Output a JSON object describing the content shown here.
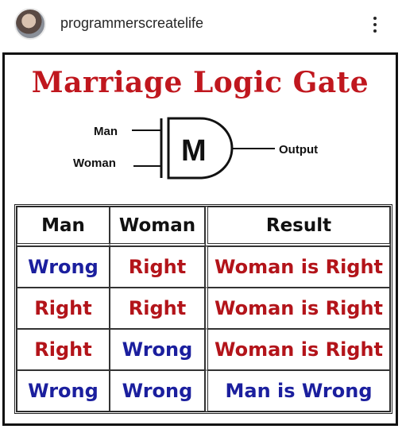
{
  "header": {
    "username": "programmerscreatelife",
    "menu_icon": "more-vertical-icon"
  },
  "post": {
    "title": "Marriage Logic Gate",
    "gate": {
      "input_1": "Man",
      "input_2": "Woman",
      "symbol": "M",
      "output": "Output"
    },
    "table": {
      "headers": [
        "Man",
        "Woman",
        "Result"
      ],
      "rows": [
        {
          "man": "Wrong",
          "woman": "Right",
          "result": "Woman is Right"
        },
        {
          "man": "Right",
          "woman": "Right",
          "result": "Woman is Right"
        },
        {
          "man": "Right",
          "woman": "Wrong",
          "result": "Woman is Right"
        },
        {
          "man": "Wrong",
          "woman": "Wrong",
          "result": "Man is Wrong"
        }
      ]
    },
    "colors": {
      "title": "#c0171e",
      "right_or_woman": "#b3141a",
      "wrong_or_man": "#1b1f9e"
    }
  }
}
